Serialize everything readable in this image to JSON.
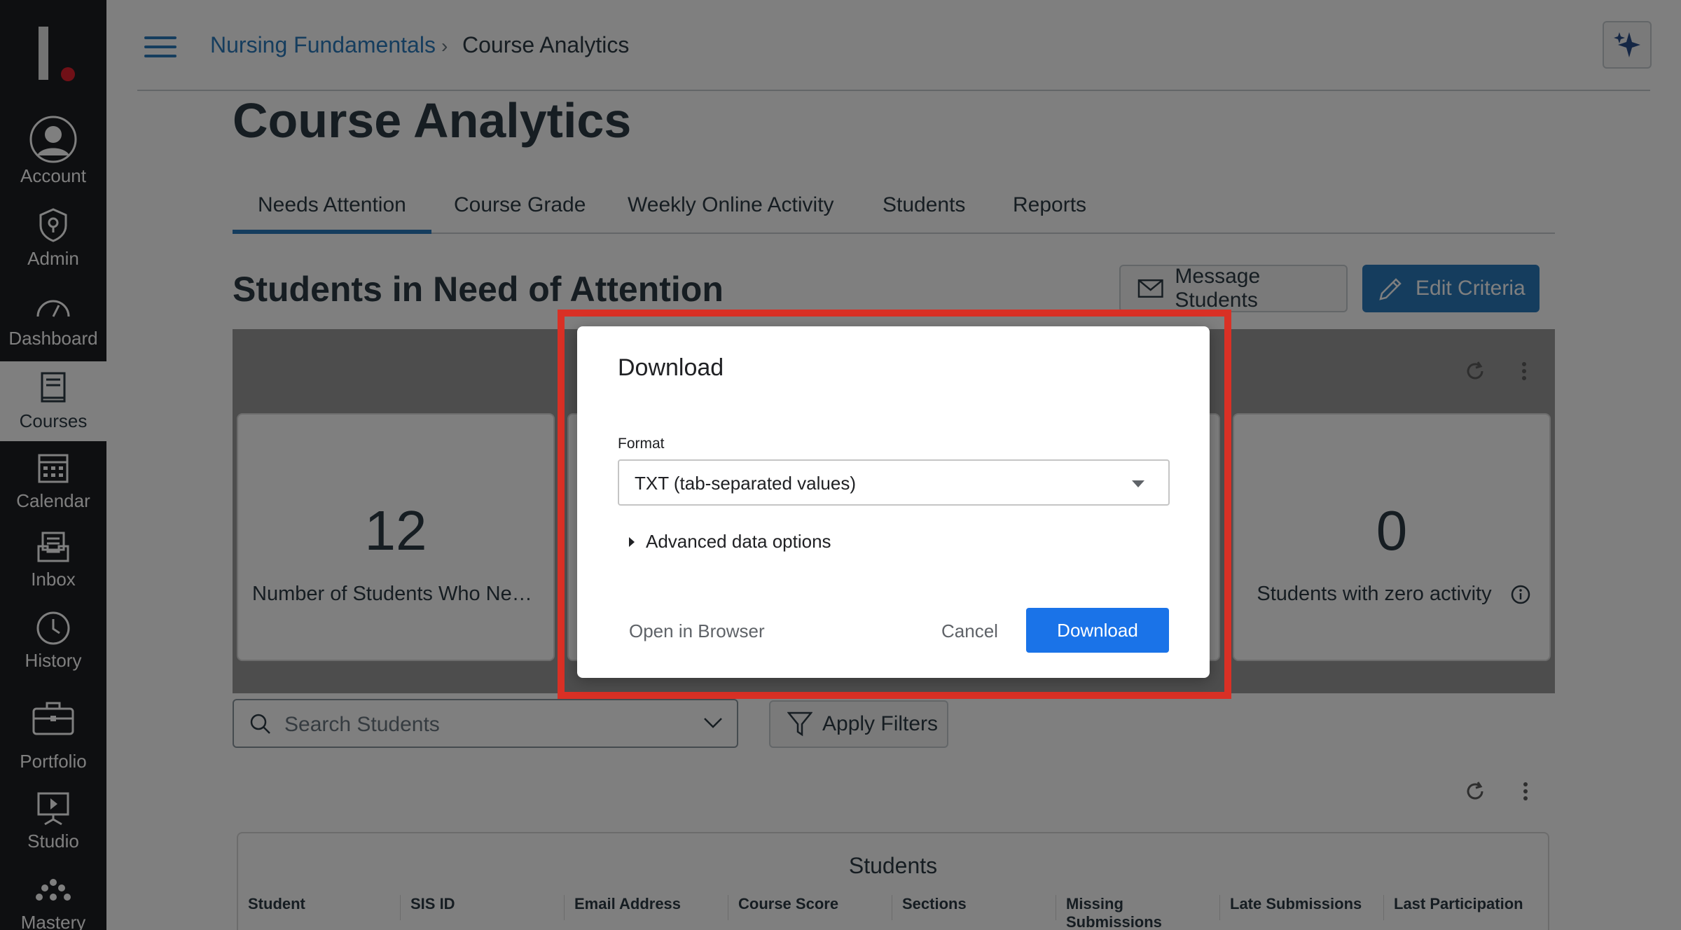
{
  "global_nav": {
    "items": [
      {
        "label": "Account",
        "icon": "account-icon"
      },
      {
        "label": "Admin",
        "icon": "admin-icon"
      },
      {
        "label": "Dashboard",
        "icon": "dashboard-icon"
      },
      {
        "label": "Courses",
        "icon": "courses-icon"
      },
      {
        "label": "Calendar",
        "icon": "calendar-icon"
      },
      {
        "label": "Inbox",
        "icon": "inbox-icon"
      },
      {
        "label": "History",
        "icon": "history-icon"
      },
      {
        "label": "Portfolio",
        "icon": "portfolio-icon"
      },
      {
        "label": "Studio",
        "icon": "studio-icon"
      },
      {
        "label": "Mastery",
        "icon": "mastery-icon"
      }
    ],
    "active": "Courses"
  },
  "breadcrumb": {
    "course": "Nursing Fundamentals",
    "separator": "›",
    "current": "Course Analytics"
  },
  "page": {
    "title": "Course Analytics",
    "tabs": [
      {
        "label": "Needs Attention"
      },
      {
        "label": "Course Grade"
      },
      {
        "label": "Weekly Online Activity"
      },
      {
        "label": "Students"
      },
      {
        "label": "Reports"
      }
    ],
    "section_title": "Students in Need of Attention",
    "message_button": "Message Students",
    "edit_button": "Edit Criteria"
  },
  "cards": [
    {
      "value": "12",
      "label": "Number of Students Who Nee..."
    },
    {
      "value": "0",
      "label": "Students with zero activity"
    }
  ],
  "search": {
    "placeholder": "Search Students"
  },
  "filter_button": "Apply Filters",
  "table": {
    "caption": "Students",
    "columns": [
      "Student",
      "SIS ID",
      "Email Address",
      "Course Score",
      "Sections",
      "Missing Submissions",
      "Late Submissions",
      "Last Participation"
    ]
  },
  "modal": {
    "title": "Download",
    "format_label": "Format",
    "format_value": "TXT (tab-separated values)",
    "advanced": "Advanced data options",
    "open_browser": "Open in Browser",
    "cancel": "Cancel",
    "download": "Download"
  },
  "colors": {
    "accent": "#2b7abc",
    "nav_bg": "#1d1f23",
    "modal_primary": "#1a73e8",
    "highlight": "#d93025"
  }
}
